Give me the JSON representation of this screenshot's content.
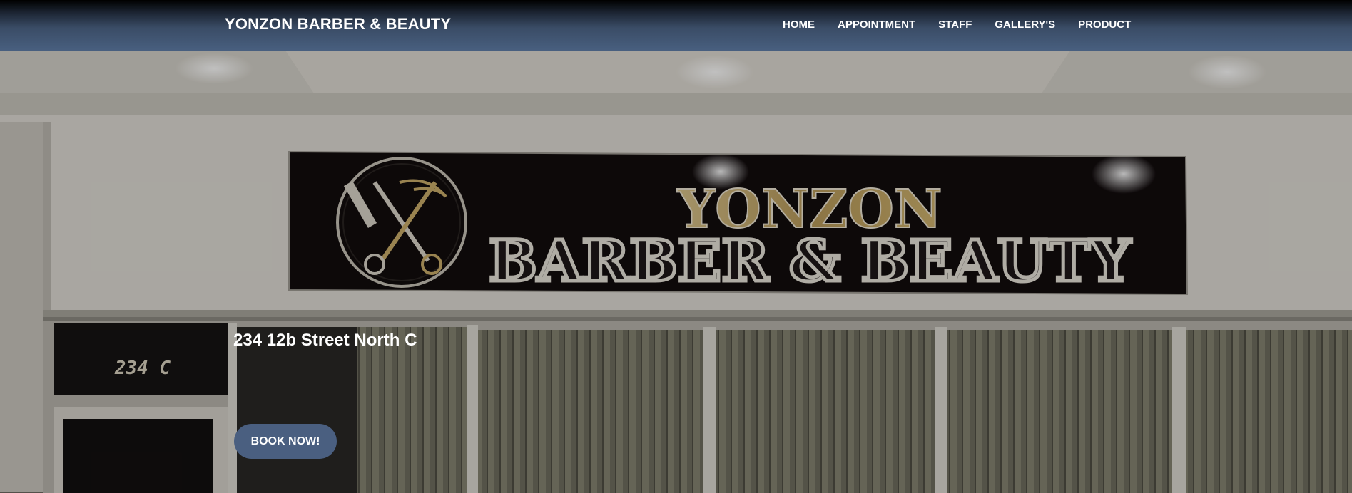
{
  "header": {
    "brand": "YONZON BARBER & BEAUTY",
    "nav": [
      {
        "label": "HOME"
      },
      {
        "label": "APPOINTMENT"
      },
      {
        "label": "STAFF"
      },
      {
        "label": "GALLERY'S"
      },
      {
        "label": "PRODUCT"
      }
    ]
  },
  "hero": {
    "storefront_sign": {
      "line1": "YONZON",
      "line2": "BARBER & BEAUTY"
    },
    "unit_number": "234 C",
    "address": "234 12b Street North C",
    "cta_label": "BOOK NOW!"
  },
  "colors": {
    "nav_bar": "#485f7f",
    "button": "#4a5f80",
    "sign_gold": "#c9ad6a",
    "text": "#ffffff"
  }
}
